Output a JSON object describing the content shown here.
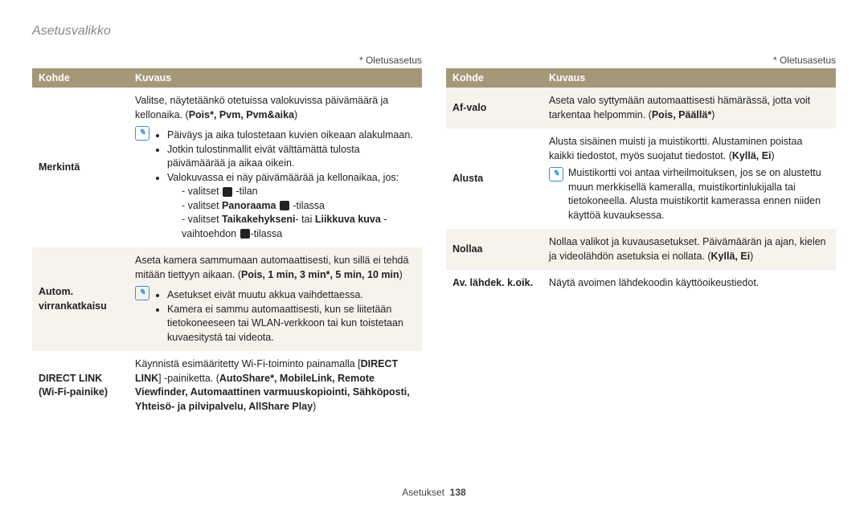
{
  "page_title": "Asetusvalikko",
  "default_note": "* Oletusasetus",
  "header": {
    "kohde": "Kohde",
    "kuvaus": "Kuvaus"
  },
  "footer": {
    "section": "Asetukset",
    "page": "138"
  },
  "left": {
    "merkinta": {
      "label": "Merkintä",
      "intro1": "Valitse, näytetäänkö otetuissa valokuvissa päivämäärä ja kellonaika. (",
      "intro_bold": "Pois*, Pvm, Pvm&aika",
      "intro2": ")",
      "note1": "Päiväys ja aika tulostetaan kuvien oikeaan alakulmaan.",
      "note2": "Jotkin tulostinmallit eivät välttämättä tulosta päivämäärää ja aikaa oikein.",
      "note3": "Valokuvassa ei näy päivämäärää ja kellonaikaa, jos:",
      "d1a": "valitset ",
      "d1b": " -tilan",
      "d2a": "valitset ",
      "d2b": "Panoraama",
      "d2c": " -tilassa",
      "d3a": "valitset ",
      "d3b": "Taikakehykseni",
      "d3c": "- tai ",
      "d3d": "Liikkuva kuva",
      "d3e": " -vaihtoehdon ",
      "d3f": "-tilassa"
    },
    "autom": {
      "label": "Autom. virrankatkaisu",
      "intro1": "Aseta kamera sammumaan automaattisesti, kun sillä ei tehdä mitään tiettyyn aikaan. (",
      "intro_bold": "Pois, 1 min, 3 min*, 5 min, 10 min",
      "intro2": ")",
      "note1": "Asetukset eivät muutu akkua vaihdettaessa.",
      "note2": "Kamera ei sammu automaattisesti, kun se liitetään tietokoneeseen tai WLAN-verkkoon tai kun toistetaan kuvaesitystä tai videota."
    },
    "dlink": {
      "label": "DIRECT LINK (Wi-Fi-painike)",
      "l1": "Käynnistä esimääritetty Wi-Fi-toiminto painamalla [",
      "l1b": "DIRECT LINK",
      "l1c": "] -painiketta. (",
      "l2": "AutoShare*, MobileLink, Remote Viewfinder, Automaattinen varmuuskopiointi, Sähköposti, Yhteisö- ja pilvipalvelu, AllShare Play",
      "l3": ")"
    }
  },
  "right": {
    "afvalo": {
      "label": "Af-valo",
      "t1": "Aseta valo syttymään automaattisesti hämärässä, jotta voit tarkentaa helpommin. (",
      "tb": "Pois, Päällä*",
      "t2": ")"
    },
    "alusta": {
      "label": "Alusta",
      "t1": "Alusta sisäinen muisti ja muistikortti. Alustaminen poistaa kaikki tiedostot, myös suojatut tiedostot. (",
      "tb": "Kyllä, Ei",
      "t2": ")",
      "note": "Muistikortti voi antaa virheilmoituksen, jos se on alustettu muun merkkisellä kameralla, muistikortinlukijalla tai tietokoneella. Alusta muistikortit kamerassa ennen niiden käyttöä kuvauksessa."
    },
    "nollaa": {
      "label": "Nollaa",
      "t1": "Nollaa valikot ja kuvausasetukset. Päivämäärän ja ajan, kielen ja videolähdön asetuksia ei nollata. (",
      "tb": "Kyllä, Ei",
      "t2": ")"
    },
    "av": {
      "label": "Av. lähdek. k.oik.",
      "t": "Näytä avoimen lähdekoodin käyttöoikeustiedot."
    }
  }
}
